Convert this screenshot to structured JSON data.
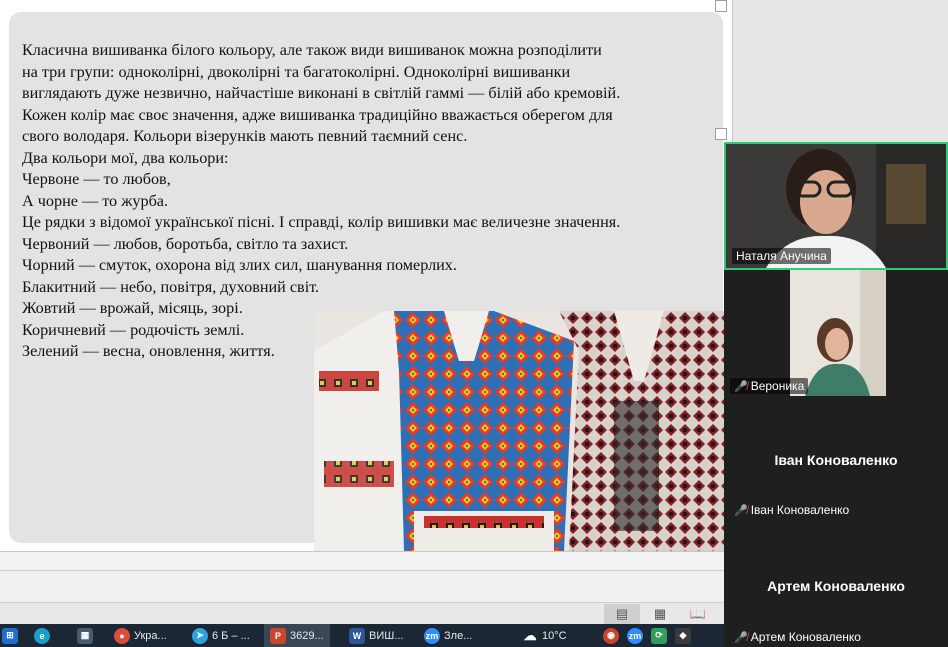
{
  "slide": {
    "lines": [
      "  Класична вишиванка білого кольору, але також види вишиванок можна розподілити",
      "на три групи: одноколірні, двоколірні та багатоколірні. Одноколірні вишиванки",
      "виглядають дуже незвично, найчастіше виконані в світлій гаммі — білій або кремовій.",
      "Кожен колір має своє значення, адже вишиванка традиційно вважається оберегом для",
      "свого володаря. Кольори візерунків мають певний таємний сенс.",
      "Два кольори мої, два кольори:",
      "Червоне — то любов,",
      "А чорне — то журба.",
      " Це рядки з відомої української пісні. І справді, колір вишивки має величезне значення.",
      "Червоний — любов, боротьба, світло та захист.",
      "Чорний — смуток, охорона від злих сил, шанування померлих.",
      "Блакитний — небо, повітря, духовний світ.",
      "Жовтий — врожай, місяць, зорі.",
      "Коричневий — родючість землі.",
      "Зелений — весна, оновлення, життя."
    ],
    "photo_icon": "embroidered-shirts-photo"
  },
  "zoom": {
    "participants": [
      {
        "name": "Наталя Анучина",
        "video": true
      },
      {
        "name": "Вероника",
        "video": true,
        "muted": true
      },
      {
        "name": "Іван Коноваленко",
        "display": "Іван  Коноވален...",
        "muted": true
      },
      {
        "name": "Артем Коноваленко",
        "display": "Артем  Коновал...",
        "muted": true
      }
    ]
  },
  "taskbar": {
    "items": [
      {
        "label": "",
        "icon": "windows-logo-icon"
      },
      {
        "label": "",
        "icon": "edge-icon"
      },
      {
        "label": "",
        "icon": "calculator-icon"
      },
      {
        "label": "Укра...",
        "icon": "chrome-icon"
      },
      {
        "label": "6 Б – ...",
        "icon": "telegram-icon"
      },
      {
        "label": "3629...",
        "icon": "powerpoint-icon"
      },
      {
        "label": "ВИШ...",
        "icon": "word-icon"
      },
      {
        "label": "Зле...",
        "icon": "zoom-icon"
      }
    ],
    "weather": "10°C"
  }
}
